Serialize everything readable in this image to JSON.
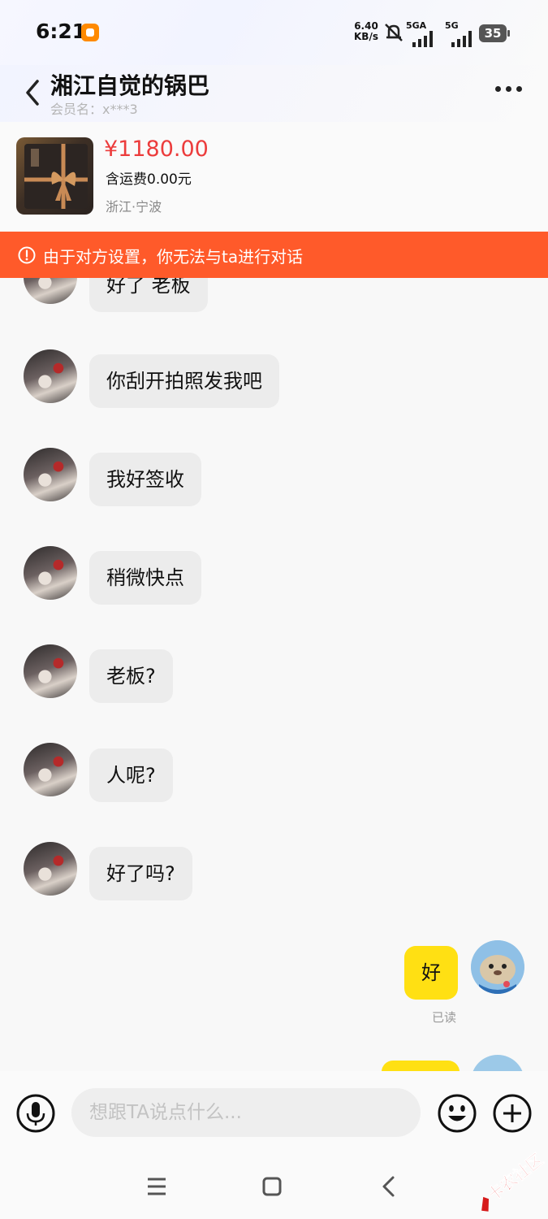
{
  "status_bar": {
    "time": "6:21",
    "net_speed_value": "6.40",
    "net_speed_unit": "KB/s",
    "signal1": "5GA",
    "signal2": "5G",
    "battery": "35"
  },
  "header": {
    "title": "湘江自觉的锅巴",
    "member": "会员名：x***3"
  },
  "product": {
    "price": "¥1180.00",
    "shipping": "含运费0.00元",
    "location": "浙江·宁波"
  },
  "warning": "由于对方设置，你无法与ta进行对话",
  "messages": [
    {
      "text": "好了 老板"
    },
    {
      "text": "你刮开拍照发我吧"
    },
    {
      "text": "我好签收"
    },
    {
      "text": "稍微快点"
    },
    {
      "text": "老板?"
    },
    {
      "text": "人呢?"
    },
    {
      "text": "好了吗?"
    }
  ],
  "my_message": {
    "text": "好",
    "status": "已读"
  },
  "input": {
    "placeholder": "想跟TA说点什么..."
  },
  "watermark": "卡农社区"
}
